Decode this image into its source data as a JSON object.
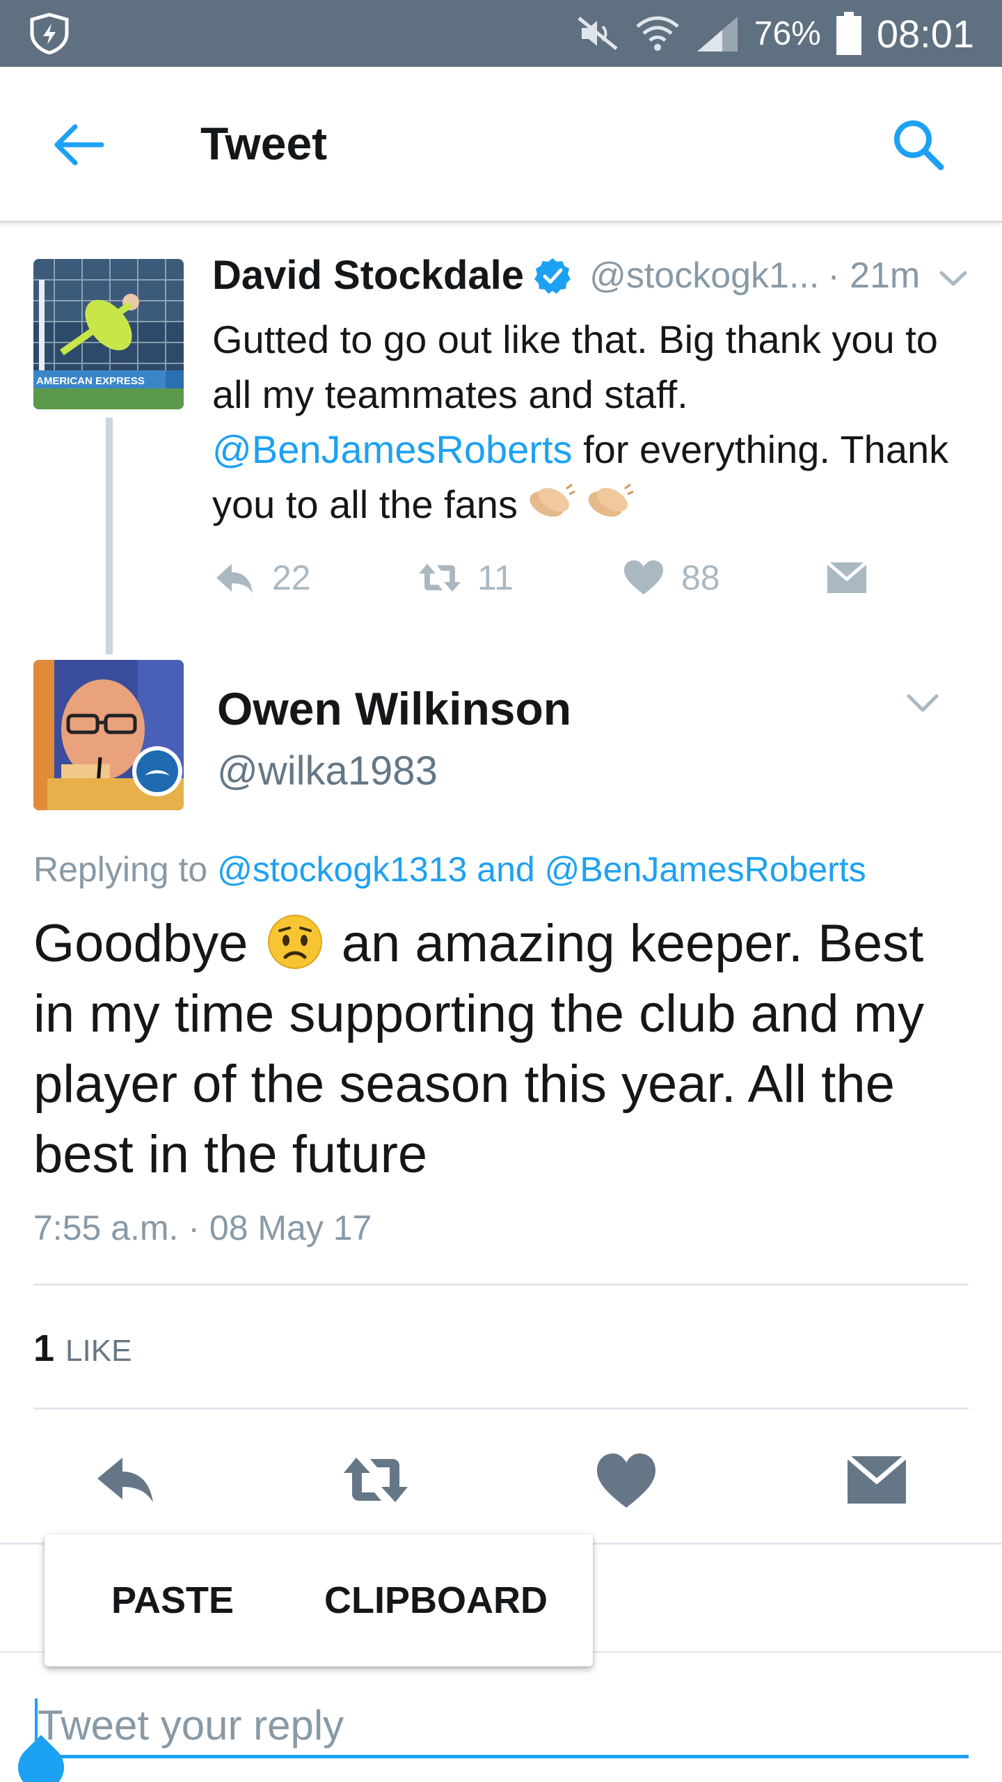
{
  "status_bar": {
    "battery_percent": "76%",
    "time": "08:01",
    "icons": [
      "shield-app-icon",
      "mute-icon",
      "wifi-icon",
      "signal-icon",
      "battery-icon"
    ]
  },
  "app_bar": {
    "title": "Tweet",
    "back_icon": "arrow-left-icon",
    "search_icon": "search-icon"
  },
  "parent_tweet": {
    "author_name": "David Stockdale",
    "verified": true,
    "handle": "@stockogk1...",
    "time": "· 21m",
    "text_before_mention": "Gutted to go out like that. Big thank you to all my teammates and staff.",
    "mention": "@BenJamesRoberts",
    "text_after_mention": "for everything. Thank you to all the fans",
    "emojis": [
      "clapping-hands",
      "clapping-hands"
    ],
    "actions": {
      "reply_count": "22",
      "retweet_count": "11",
      "like_count": "88"
    }
  },
  "main_tweet": {
    "author_name": "Owen Wilkinson",
    "handle": "@wilka1983",
    "replying_prefix": "Replying to",
    "replying_mention_1": "@stockogk1313",
    "replying_and": "and",
    "replying_mention_2": "@BenJamesRoberts",
    "text_before_emoji": "Goodbye",
    "emoji": "worried-face",
    "text_after_emoji": "an amazing keeper. Best in my time supporting the club and my player of the season this year. All the best in the future",
    "timestamp": "7:55 a.m. · 08 May 17",
    "likes_count": "1",
    "likes_label": "LIKE"
  },
  "context_menu": {
    "paste_label": "PASTE",
    "clipboard_label": "CLIPBOARD"
  },
  "composer": {
    "placeholder": "Tweet your reply",
    "value": ""
  },
  "colors": {
    "status_bar": "#5f7080",
    "accent": "#1da1f2",
    "muted_text": "#8899a6",
    "action_icon_dark": "#657786",
    "action_icon_light": "#aab8c2"
  }
}
